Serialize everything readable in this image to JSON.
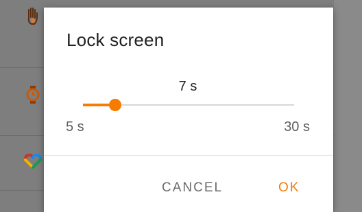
{
  "dialog": {
    "title": "Lock screen",
    "slider": {
      "value_label": "7 s",
      "min_label": "5 s",
      "max_label": "30 s",
      "min": 5,
      "max": 30,
      "value": 7
    },
    "buttons": {
      "cancel_label": "CANCEL",
      "ok_label": "OK"
    }
  },
  "background": {
    "icons": [
      "hand-icon",
      "watch-icon",
      "heart-icon"
    ]
  },
  "colors": {
    "accent": "#f57c00",
    "text_primary": "#212121",
    "text_secondary": "#5f5f5f",
    "scrim": "#7e7e7e"
  }
}
